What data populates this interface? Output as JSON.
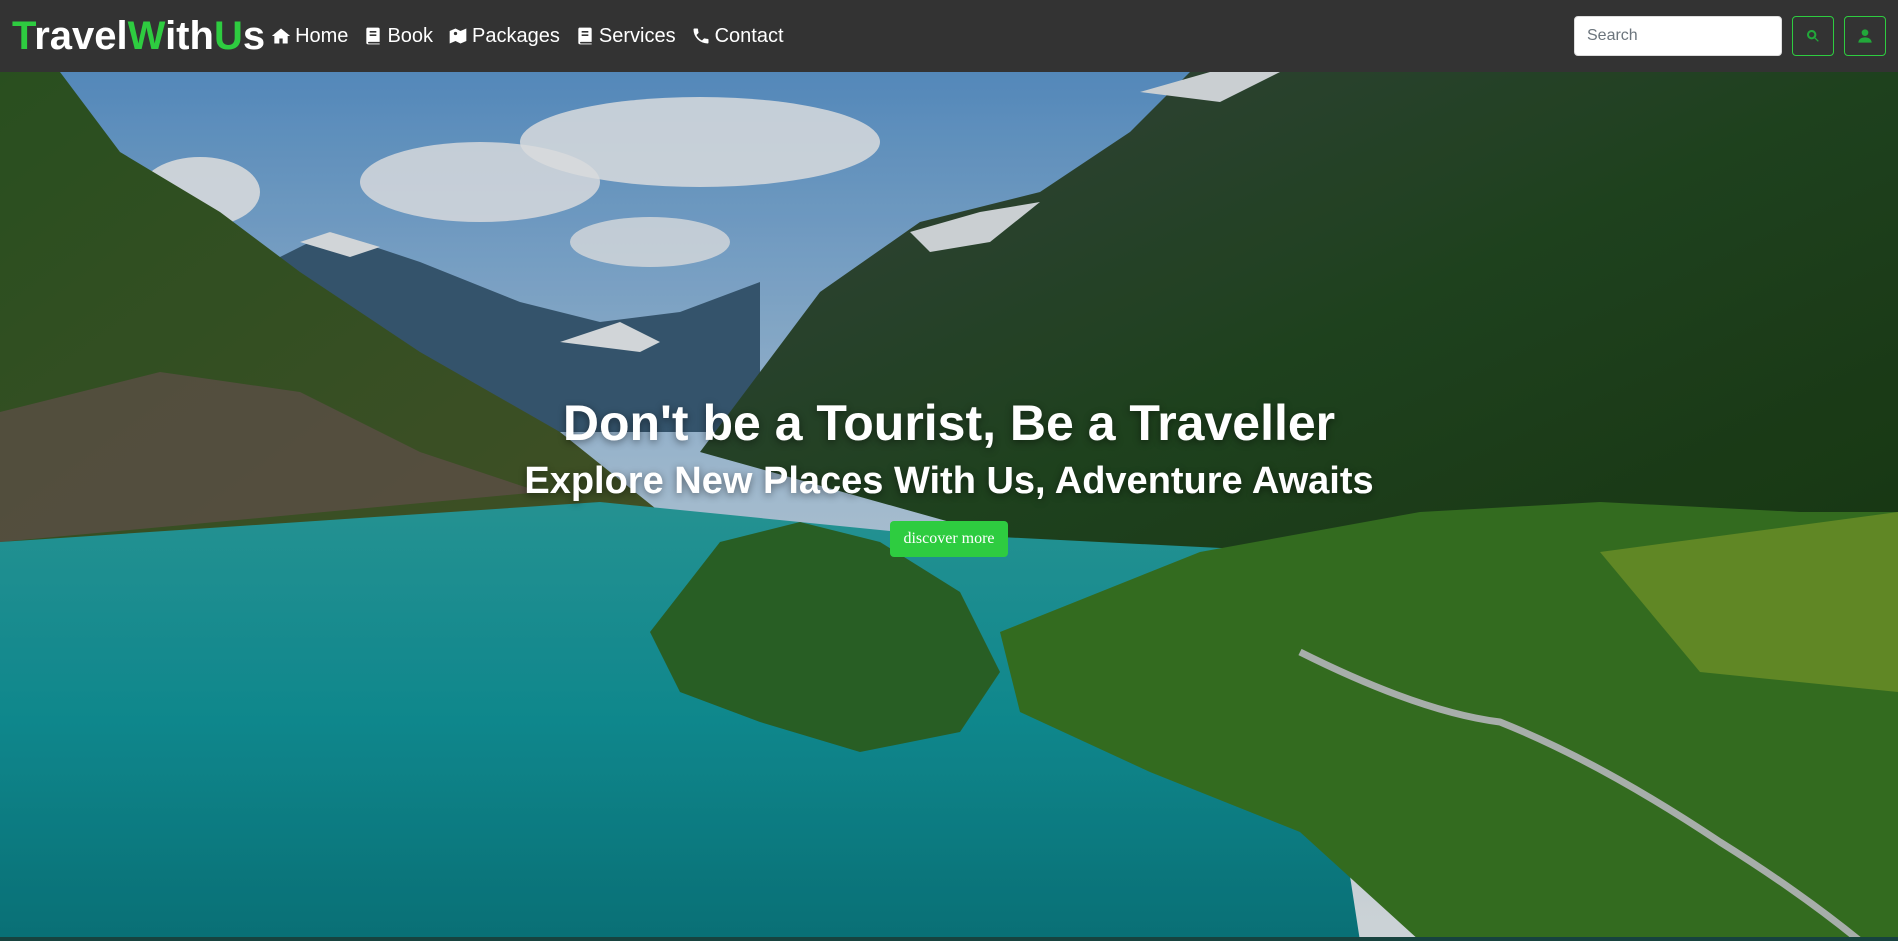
{
  "brand": {
    "text": "TravelWithUs",
    "parts": [
      "T",
      "ravel",
      "W",
      "ith",
      "U",
      "s"
    ]
  },
  "nav": {
    "items": [
      {
        "label": "Home",
        "icon": "home-icon"
      },
      {
        "label": "Book",
        "icon": "book-icon"
      },
      {
        "label": "Packages",
        "icon": "packages-icon"
      },
      {
        "label": "Services",
        "icon": "services-icon"
      },
      {
        "label": "Contact",
        "icon": "phone-icon"
      }
    ]
  },
  "search": {
    "placeholder": "Search",
    "value": ""
  },
  "actions": {
    "search_icon": "search-icon",
    "user_icon": "user-icon"
  },
  "hero": {
    "title": "Don't be a Tourist, Be a Traveller",
    "subtitle": "Explore New Places With Us, Adventure Awaits",
    "cta_label": "discover more"
  },
  "colors": {
    "navbar_bg": "#333333",
    "accent": "#2ecc40",
    "text": "#ffffff"
  }
}
